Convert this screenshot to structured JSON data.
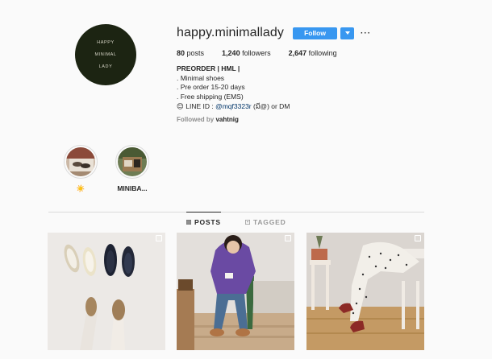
{
  "profile": {
    "avatar_lines": [
      "HAPPY",
      "MINIMAL",
      "LADY"
    ],
    "username": "happy.minimallady",
    "follow_label": "Follow",
    "more_label": "···",
    "stats": [
      {
        "count": "80",
        "label": "posts"
      },
      {
        "count": "1,240",
        "label": "followers"
      },
      {
        "count": "2,647",
        "label": "following"
      }
    ],
    "bio": {
      "name": "PREORDER | HML |",
      "line1": ". Minimal shoes",
      "line2": ". Pre order 15-20 days",
      "line3": ". Free shipping (EMS)",
      "line4_emoji": "😊",
      "line4_prefix": " LINE ID : ",
      "line4_link": "@mqf3323r",
      "line4_suffix": " (มี@) or DM"
    },
    "followed_by_prefix": "Followed by ",
    "followed_by_user": "vahtnig"
  },
  "highlights": [
    {
      "label": "☀️"
    },
    {
      "label": "MINIBA..."
    }
  ],
  "tabs": [
    {
      "label": "POSTS",
      "active": true
    },
    {
      "label": "TAGGED",
      "active": false
    }
  ],
  "colors": {
    "accent": "#3897f0",
    "link": "#003569",
    "avatar_bg": "#1c2412"
  }
}
